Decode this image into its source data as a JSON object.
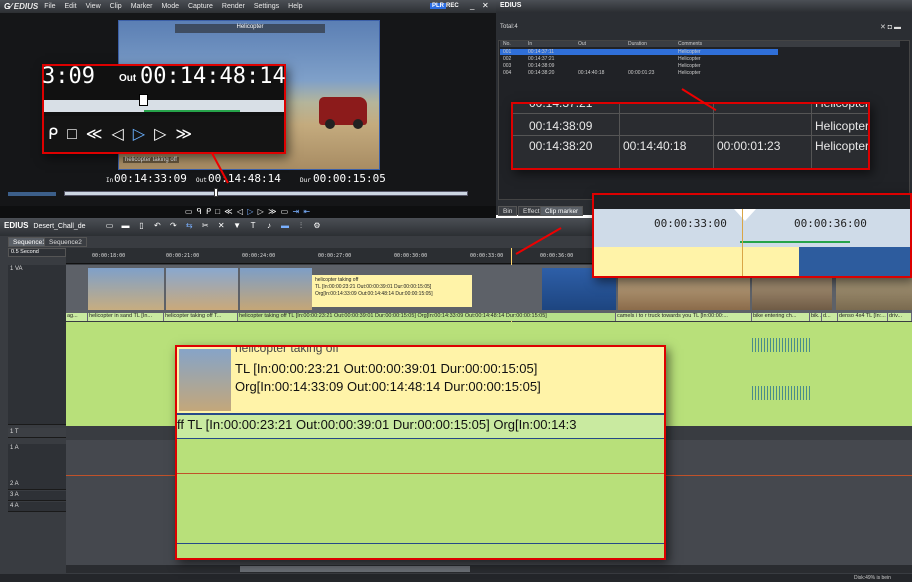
{
  "player": {
    "app_name": "EDIUS",
    "menu": [
      "File",
      "Edit",
      "View",
      "Clip",
      "Marker",
      "Mode",
      "Capture",
      "Render",
      "Settings",
      "Help"
    ],
    "status": "PLR",
    "rec": "REC",
    "preview_title": "Helicopter",
    "preview_caption": "helicopter taking off",
    "in_label": "In",
    "in_tc": "00:14:33:09",
    "out_label": "Out",
    "out_tc": "00:14:48:14",
    "dur_label": "Dur",
    "dur_tc": "00:00:15:05"
  },
  "zoom_player": {
    "tc_partial": "3:09",
    "out_label": "Out",
    "out_tc": "00:14:48:14"
  },
  "marker_panel": {
    "title": "EDIUS",
    "total": "Total:4",
    "columns": [
      "No.",
      "In",
      "Out",
      "Duration",
      "Comments"
    ],
    "rows": [
      {
        "no": "001",
        "in": "00:14:37:11",
        "out": "",
        "dur": "",
        "comment": "Helicopter"
      },
      {
        "no": "002",
        "in": "00:14:37:21",
        "out": "",
        "dur": "",
        "comment": "Helicopter"
      },
      {
        "no": "003",
        "in": "00:14:38:09",
        "out": "",
        "dur": "",
        "comment": "Helicopter"
      },
      {
        "no": "004",
        "in": "00:14:38:20",
        "out": "00:14:40:18",
        "dur": "00:00:01:23",
        "comment": "Helicopter"
      }
    ],
    "tabs": [
      "Bin",
      "Effect",
      "Clip marker"
    ]
  },
  "zoom_list": {
    "rows": [
      {
        "in": "00:14:37:21",
        "out": "",
        "dur": "",
        "comment": "Helicopter"
      },
      {
        "in": "00:14:38:09",
        "out": "",
        "dur": "",
        "comment": "Helicopter"
      },
      {
        "in": "00:14:38:20",
        "out": "00:14:40:18",
        "dur": "00:00:01:23",
        "comment": "Helicopter"
      }
    ]
  },
  "timeline": {
    "app_name": "EDIUS",
    "project": "Desert_Chall_de",
    "sequences": [
      "Sequence1",
      "Sequence2"
    ],
    "zoom": "0.5 Second",
    "ruler": [
      "00:00:18:00",
      "00:00:21:00",
      "00:00:24:00",
      "00:00:27:00",
      "00:00:30:00",
      "00:00:33:00",
      "00:00:36:00"
    ],
    "tracks": [
      "1 VA",
      "1 T",
      "1 A",
      "2 A",
      "3 A",
      "4 A"
    ],
    "clips": [
      "ag...",
      "helicopter in sand  TL [In...",
      "helicopter taking off  T...",
      "helicopter taking off  TL [In:00:00:23:21 Out:00:00:39:01 Dur:00:00:15:05]  Org[In:00:14:33:09 Out:00:14:48:14 Dur:00:00:15:05]",
      "camels i to r truck towards you  TL [In:00:00:...",
      "bike entering ch...",
      "bik...",
      "d...",
      "denso 4x4  TL [In:...",
      "driv..."
    ],
    "tooltip": {
      "title": "helicopter taking off",
      "line1": "TL [In:00:00:23:21 Out:00:00:39:01 Dur:00:00:15:05]",
      "line2": "Org[In:00:14:33:09 Out:00:14:48:14 Dur:00:00:15:05]"
    },
    "status": "Disk:49% is bein"
  },
  "zoom_ruler": {
    "t1": "00:00:33:00",
    "t2": "00:00:36:00"
  },
  "zoom_tooltip": {
    "title": "helicopter taking off",
    "line1": "TL [In:00:00:23:21 Out:00:00:39:01 Dur:00:00:15:05]",
    "line2": "Org[In:00:14:33:09 Out:00:14:48:14 Dur:00:00:15:05]",
    "clip_text": "ff  TL [In:00:00:23:21 Out:00:00:39:01 Dur:00:00:15:05]  Org[In:00:14:3"
  },
  "colors": {
    "accent_red": "#dd1111",
    "clip_green": "#c9eaa0",
    "audio_green": "#b8e07a",
    "tooltip_yellow": "#fff3a8",
    "selection_blue": "#2f6fd8"
  }
}
